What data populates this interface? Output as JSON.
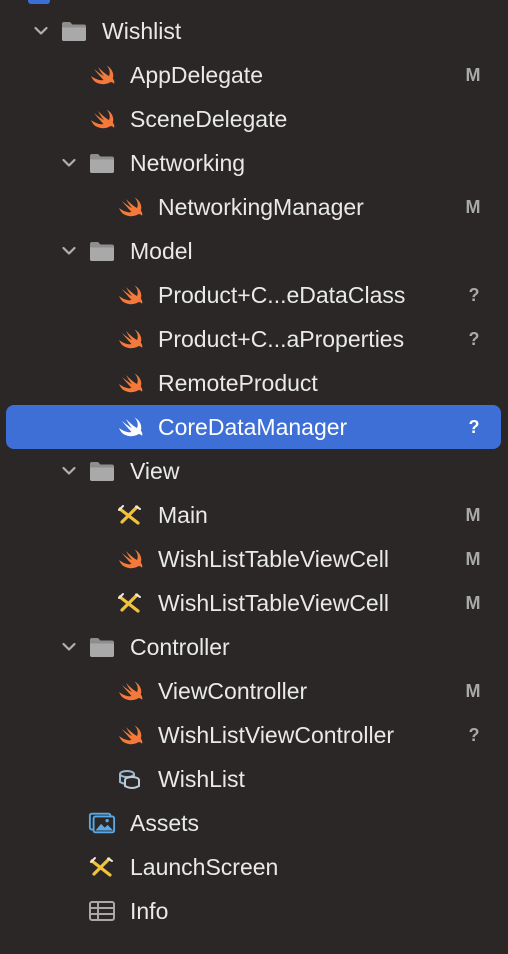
{
  "navigator": {
    "items": [
      {
        "label": "Wishlist",
        "icon": "folder-icon",
        "status": "",
        "level": 0,
        "expanded": true
      },
      {
        "label": "AppDelegate",
        "icon": "swift-file-icon",
        "status": "M",
        "level": 1
      },
      {
        "label": "SceneDelegate",
        "icon": "swift-file-icon",
        "status": "",
        "level": 1
      },
      {
        "label": "Networking",
        "icon": "folder-icon",
        "status": "",
        "level": 1,
        "expanded": true
      },
      {
        "label": "NetworkingManager",
        "icon": "swift-file-icon",
        "status": "M",
        "level": 2
      },
      {
        "label": "Model",
        "icon": "folder-icon",
        "status": "",
        "level": 1,
        "expanded": true
      },
      {
        "label": "Product+C...eDataClass",
        "icon": "swift-file-icon",
        "status": "?",
        "level": 2
      },
      {
        "label": "Product+C...aProperties",
        "icon": "swift-file-icon",
        "status": "?",
        "level": 2
      },
      {
        "label": "RemoteProduct",
        "icon": "swift-file-icon",
        "status": "",
        "level": 2
      },
      {
        "label": "CoreDataManager",
        "icon": "swift-file-icon",
        "status": "?",
        "level": 2,
        "selected": true
      },
      {
        "label": "View",
        "icon": "folder-icon",
        "status": "",
        "level": 1,
        "expanded": true
      },
      {
        "label": "Main",
        "icon": "storyboard-icon",
        "status": "M",
        "level": 2
      },
      {
        "label": "WishListTableViewCell",
        "icon": "swift-file-icon",
        "status": "M",
        "level": 2
      },
      {
        "label": "WishListTableViewCell",
        "icon": "xib-icon",
        "status": "M",
        "level": 2
      },
      {
        "label": "Controller",
        "icon": "folder-icon",
        "status": "",
        "level": 1,
        "expanded": true
      },
      {
        "label": "ViewController",
        "icon": "swift-file-icon",
        "status": "M",
        "level": 2
      },
      {
        "label": "WishListViewController",
        "icon": "swift-file-icon",
        "status": "?",
        "level": 2
      },
      {
        "label": "WishList",
        "icon": "core-data-model-icon",
        "status": "",
        "level": 2
      },
      {
        "label": "Assets",
        "icon": "asset-catalog-icon",
        "status": "",
        "level": 1
      },
      {
        "label": "LaunchScreen",
        "icon": "storyboard-icon",
        "status": "",
        "level": 1
      },
      {
        "label": "Info",
        "icon": "plist-icon",
        "status": "",
        "level": 1
      }
    ]
  },
  "colors": {
    "background": "#2a2726",
    "selection": "#3e6fd6",
    "swift_orange": "#f4793b",
    "storyboard_yellow": "#f2c33a",
    "folder_gray": "#a9a9a9",
    "status_gray": "#a9a9a9"
  }
}
